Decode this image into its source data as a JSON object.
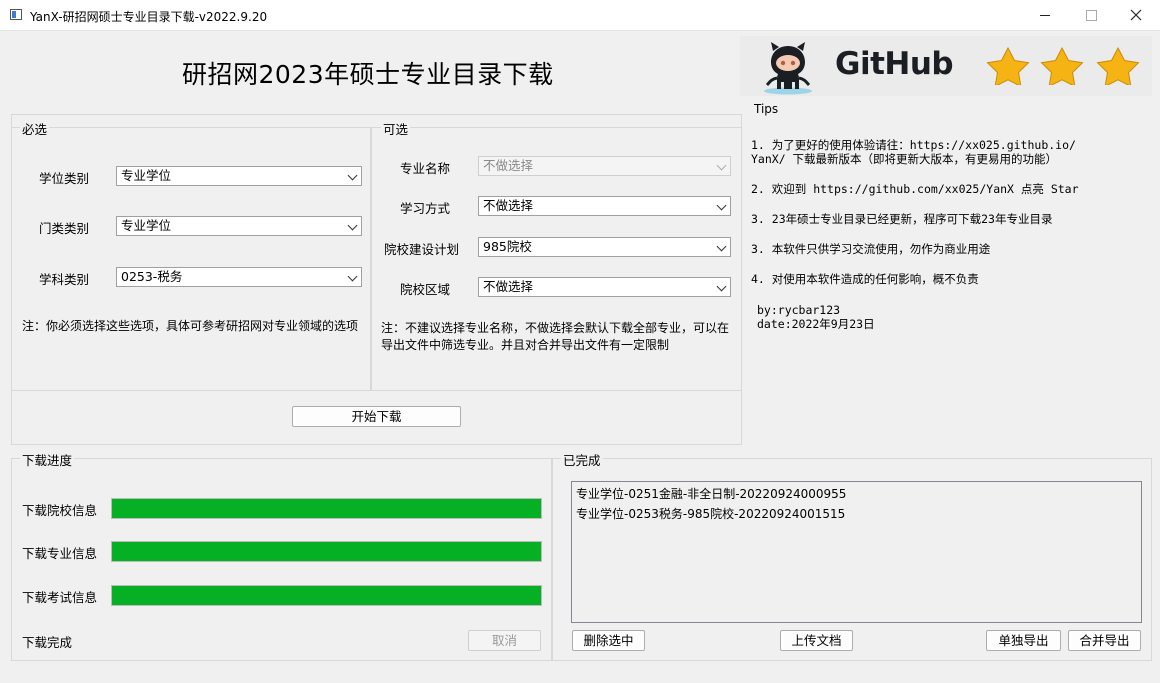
{
  "window": {
    "title": "YanX-研招网硕士专业目录下载-v2022.9.20"
  },
  "heading": "研招网2023年硕士专业目录下载",
  "banner": {
    "brand_text": "GitHub",
    "star_count": 3,
    "star_color": "#f5b414"
  },
  "required": {
    "title": "必选",
    "fields": [
      {
        "label": "学位类别",
        "value": "专业学位"
      },
      {
        "label": "门类类别",
        "value": "专业学位"
      },
      {
        "label": "学科类别",
        "value": "0253-税务"
      }
    ],
    "note": "注：你必须选择这些选项，具体可参考研招网对专业领域的选项"
  },
  "optional": {
    "title": "可选",
    "fields": [
      {
        "label": "专业名称",
        "value": "不做选择",
        "disabled": true
      },
      {
        "label": "学习方式",
        "value": "不做选择"
      },
      {
        "label": "院校建设计划",
        "value": "985院校"
      },
      {
        "label": "院校区域",
        "value": "不做选择"
      }
    ],
    "note": "注：不建议选择专业名称，不做选择会默认下载全部专业，可以在导出文件中筛选专业。并且对合并导出文件有一定限制"
  },
  "start_button": "开始下载",
  "tips": {
    "title": "Tips",
    "lines": [
      "1. 为了更好的使用体验请往：https://xx025.github.io/",
      "YanX/ 下载最新版本（即将更新大版本，有更易用的功能）",
      "2. 欢迎到 https://github.com/xx025/YanX 点亮 Star",
      "3. 23年硕士专业目录已经更新，程序可下载23年专业目录",
      "3. 本软件只供学习交流使用，勿作为商业用途",
      "4. 对使用本软件造成的任何影响，概不负责"
    ],
    "author": "by:rycbar123",
    "date": "date:2022年9月23日"
  },
  "progress": {
    "title": "下载进度",
    "items": [
      {
        "label": "下载院校信息",
        "value": 1.0
      },
      {
        "label": "下载专业信息",
        "value": 1.0
      },
      {
        "label": "下载考试信息",
        "value": 1.0
      }
    ],
    "fill_color": "#06b025",
    "status": "下载完成",
    "cancel_label": "取消"
  },
  "completed": {
    "title": "已完成",
    "items": [
      "专业学位-0251金融-非全日制-20220924000955",
      "专业学位-0253税务-985院校-20220924001515"
    ],
    "buttons": {
      "delete": "删除选中",
      "upload": "上传文档",
      "export_single": "单独导出",
      "export_merge": "合并导出"
    }
  }
}
